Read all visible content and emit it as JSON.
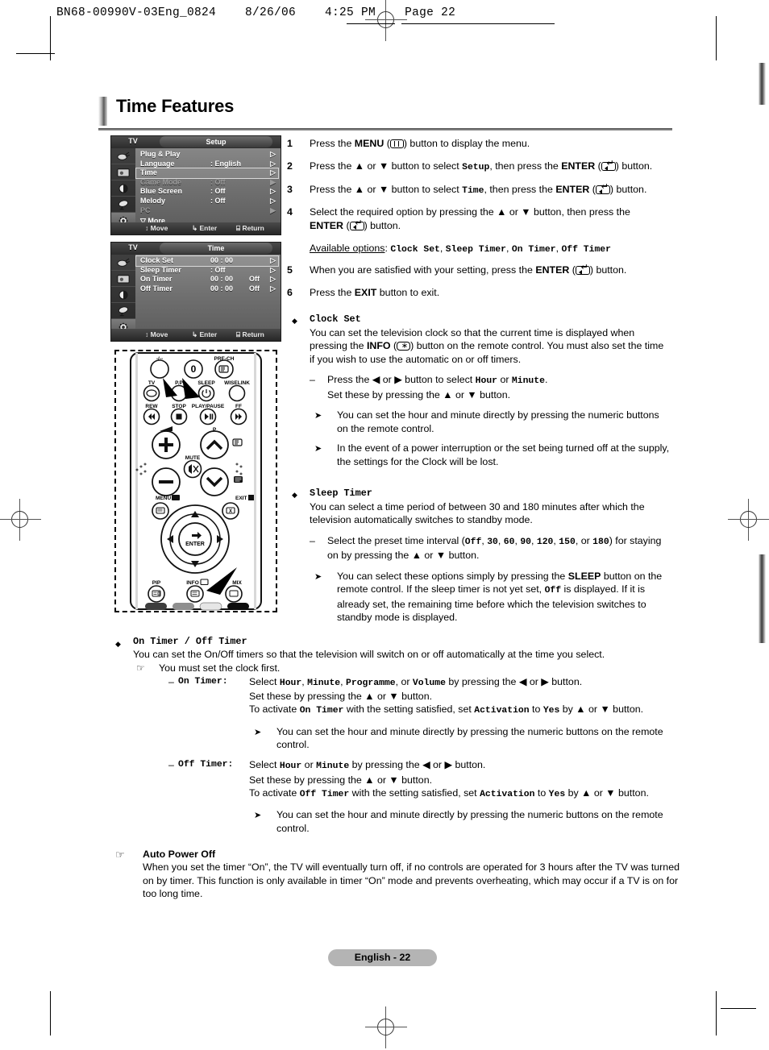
{
  "file_header": "BN68-00990V-03Eng_0824    8/26/06    4:25 PM    Page 22",
  "page_title": "Time Features",
  "footer": {
    "label": "English - 22"
  },
  "osd_setup": {
    "source_label": "TV",
    "title": "Setup",
    "rows": [
      {
        "label": "Plug & Play",
        "value": "",
        "value2": "",
        "arrow": "▷",
        "dim": false,
        "highlight": false
      },
      {
        "label": "Language",
        "value": ": English",
        "value2": "",
        "arrow": "▷",
        "dim": false,
        "highlight": false
      },
      {
        "label": "Time",
        "value": "",
        "value2": "",
        "arrow": "▷",
        "dim": false,
        "highlight": true
      },
      {
        "label": "Game Mode",
        "value": ": Off",
        "value2": "",
        "arrow": "▶",
        "dim": true,
        "highlight": false
      },
      {
        "label": "Blue Screen",
        "value": ": Off",
        "value2": "",
        "arrow": "▷",
        "dim": false,
        "highlight": false
      },
      {
        "label": "Melody",
        "value": ": Off",
        "value2": "",
        "arrow": "▷",
        "dim": false,
        "highlight": false
      },
      {
        "label": "PC",
        "value": "",
        "value2": "",
        "arrow": "▶",
        "dim": true,
        "highlight": false
      }
    ],
    "more": "▽ More",
    "hints": {
      "move": "↕ Move",
      "enter": "↳ Enter",
      "return": "⌸ Return"
    }
  },
  "osd_time": {
    "source_label": "TV",
    "title": "Time",
    "rows": [
      {
        "label": "Clock Set",
        "value": "00 : 00",
        "value2": "",
        "arrow": "▷",
        "dim": false,
        "highlight": true
      },
      {
        "label": "Sleep Timer",
        "value": ": Off",
        "value2": "",
        "arrow": "▷",
        "dim": false,
        "highlight": false
      },
      {
        "label": "On Timer",
        "value": "00 : 00",
        "value2": "Off",
        "arrow": "▷",
        "dim": false,
        "highlight": false
      },
      {
        "label": "Off Timer",
        "value": "00 : 00",
        "value2": "Off",
        "arrow": "▷",
        "dim": false,
        "highlight": false
      }
    ],
    "hints": {
      "move": "↕ Move",
      "enter": "↳ Enter",
      "return": "⌸ Return"
    }
  },
  "remote": {
    "labels": {
      "prech": "PRE-CH",
      "zero": "0",
      "dashes": "-/--",
      "tv": "TV",
      "pp": "P.P",
      "sleep": "SLEEP",
      "wiselink": "WISELINK",
      "rew": "REW",
      "stop": "STOP",
      "playpause": "PLAY/PAUSE",
      "ff": "FF",
      "mute": "MUTE",
      "p": "P",
      "menu": "MENU",
      "exit": "EXIT",
      "enter": "ENTER",
      "pip": "PIP",
      "info": "INFO",
      "mix": "MIX"
    }
  },
  "steps": [
    {
      "num": "1",
      "html": "Press the <b>MENU</b> (<span class=\"keyico ico-menu\"></span>) button to display the menu."
    },
    {
      "num": "2",
      "html": "Press the ▲ or ▼ button to select <span class=\"mono\">Setup</span>, then press the <b>ENTER</b> (<span class=\"keyico ico-enter\"></span>) button."
    },
    {
      "num": "3",
      "html": "Press the ▲ or ▼ button to select <span class=\"mono\">Time</span>, then press the <b>ENTER</b> (<span class=\"keyico ico-enter\"></span>) button."
    },
    {
      "num": "4",
      "html": "Select the required option by pressing the ▲ or ▼ button, then press the<br><b>ENTER</b> (<span class=\"keyico ico-enter\"></span>) button."
    },
    {
      "num": "",
      "html": "<span class=\"ul\">Available options</span>: <span class=\"mono\">Clock Set</span>, <span class=\"mono\">Sleep Timer</span>, <span class=\"mono\">On Timer</span>, <span class=\"mono\">Off Timer</span>"
    },
    {
      "num": "5",
      "html": "When you are satisfied with your setting, press the <b>ENTER</b> (<span class=\"keyico ico-enter\"></span>) button."
    },
    {
      "num": "6",
      "html": "Press the <b>EXIT</b> button to exit."
    }
  ],
  "clock_set": {
    "heading": "Clock Set",
    "body": "You can set the television clock so that the current time is displayed when pressing the <b>INFO</b> (<span class=\"keyico ico-info\"></span>) button on the remote control. You must also set the time if you wish to use the automatic on or off timers.",
    "dash": "Press the ◀ or ▶ button to select <span class=\"mono\">Hour</span> or <span class=\"mono\">Minute</span>.<br>Set these by pressing the ▲ or ▼ button.",
    "notes": [
      "You can set the hour and minute directly by pressing the numeric buttons on the remote control.",
      "In the event of a power interruption or the set being turned off at the supply, the settings for the Clock will be lost."
    ]
  },
  "sleep_timer": {
    "heading": "Sleep Timer",
    "body": "You can select a time period of between 30 and 180 minutes after which the television automatically switches to standby mode.",
    "dash": "Select the preset time interval (<span class=\"mono\">Off</span>, <span class=\"mono\">30</span>, <span class=\"mono\">60</span>, <span class=\"mono\">90</span>, <span class=\"mono\">120</span>, <span class=\"mono\">150</span>, or <span class=\"mono\">180</span>) for staying on by pressing the ▲ or ▼ button.",
    "note": "You can select these options simply by pressing the <b>SLEEP</b> button on the remote control. If the sleep timer is not yet set, <span class=\"mono\">Off</span> is displayed. If it is already set, the remaining time before which the television switches to standby mode is displayed.",
    "intervals": [
      "Off",
      "30",
      "60",
      "90",
      "120",
      "150",
      "180"
    ]
  },
  "on_off_timer": {
    "heading": "On Timer / Off Timer",
    "body": "You can set the On/Off timers so that the television will switch on or off automatically at the time you select.",
    "hand_note": "You must set the clock first.",
    "on_timer": {
      "label": "On Timer",
      "lines": [
        "Select <span class=\"mono\">Hour</span>, <span class=\"mono\">Minute</span>, <span class=\"mono\">Programme</span>, or <span class=\"mono\">Volume</span> by pressing the ◀ or ▶ button.",
        "Set these by pressing the ▲ or ▼ button.",
        "To activate <span class=\"mono\">On Timer</span> with the setting satisfied, set <span class=\"mono\">Activation</span> to <span class=\"mono\">Yes</span> by ▲ or ▼ button."
      ],
      "note": "You can set the hour and minute directly by pressing the numeric buttons on the remote control."
    },
    "off_timer": {
      "label": "Off Timer",
      "lines": [
        "Select <span class=\"mono\">Hour</span> or <span class=\"mono\">Minute</span> by pressing the ◀ or ▶ button.",
        "Set these by pressing the ▲ or ▼ button.",
        "To activate <span class=\"mono\">Off Timer</span> with the setting satisfied, set <span class=\"mono\">Activation</span> to <span class=\"mono\">Yes</span> by ▲ or ▼ button."
      ],
      "note": "You can set the hour and minute directly by pressing the numeric buttons on the remote control."
    }
  },
  "auto_power_off": {
    "heading": "Auto Power Off",
    "body": "When you set the timer “On”, the TV will eventually turn off, if no controls are operated for 3 hours after the TV was turned on by timer. This function is only available in timer “On” mode and prevents overheating, which may occur if a TV is on for too long time."
  }
}
